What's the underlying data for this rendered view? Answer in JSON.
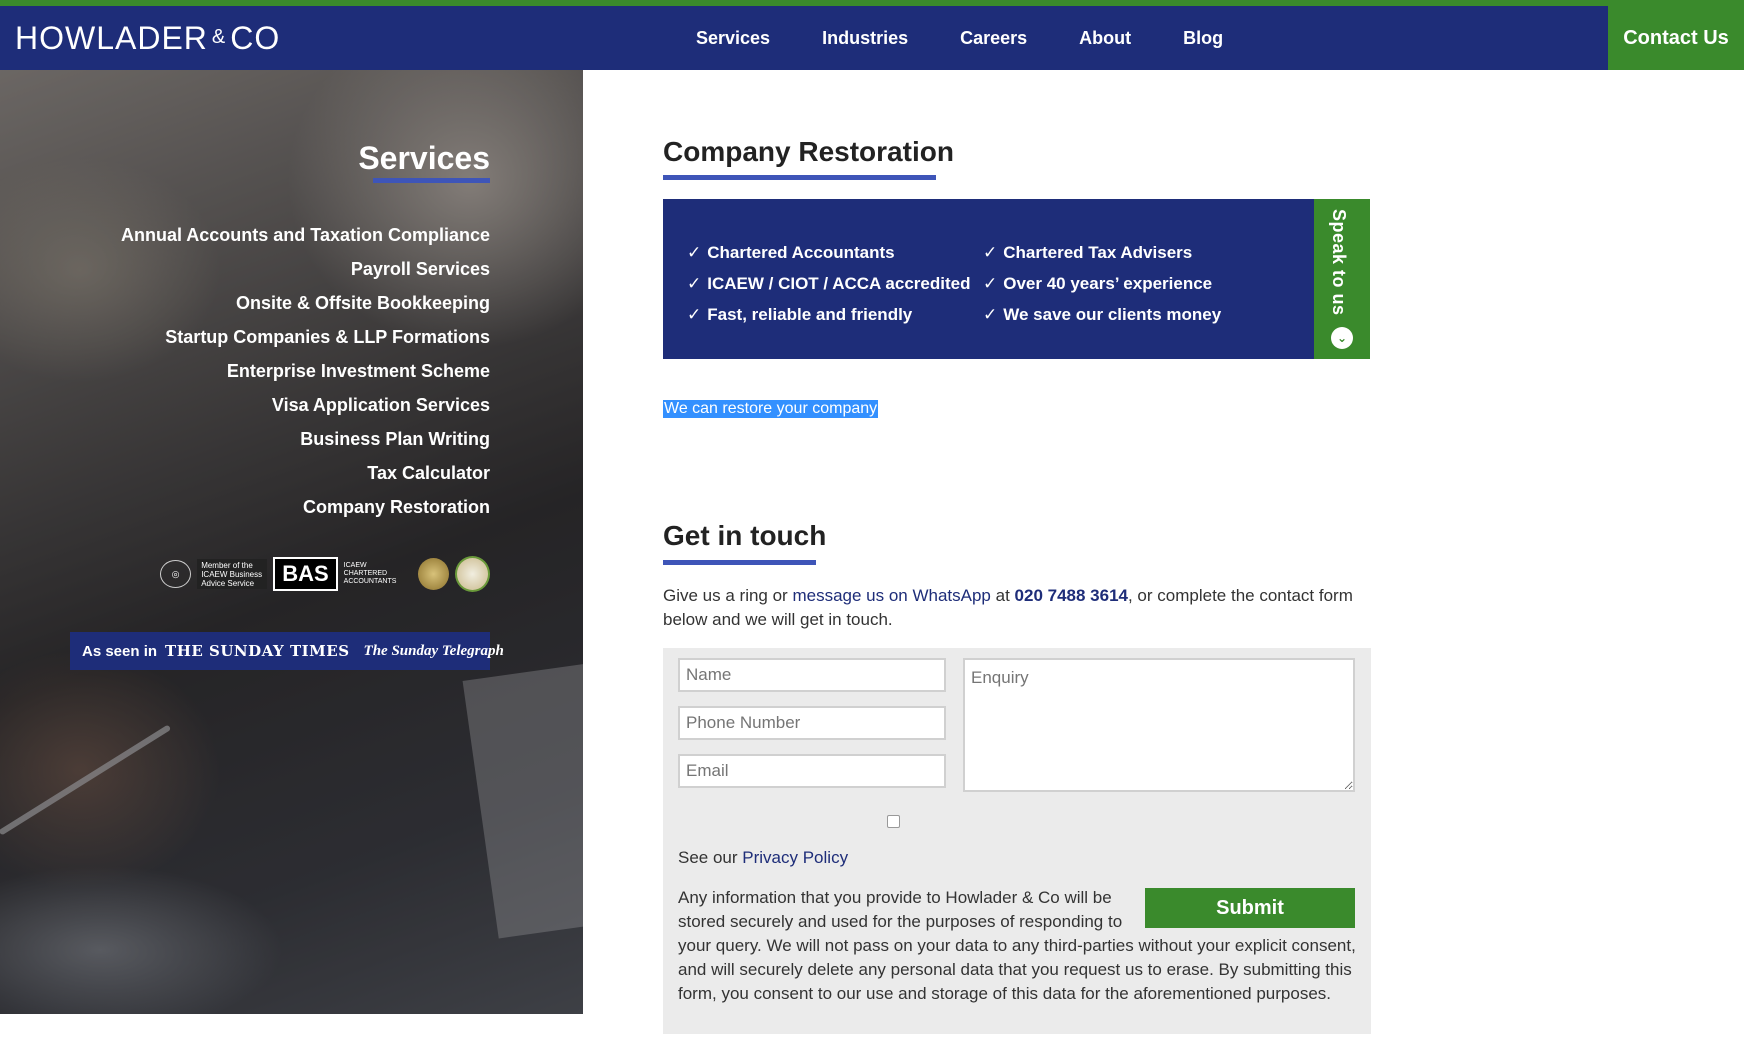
{
  "header": {
    "logo_main": "HOWLADER",
    "logo_amp": "&",
    "logo_co": "CO",
    "nav": [
      "Services",
      "Industries",
      "Careers",
      "About",
      "Blog"
    ],
    "contact_label": "Contact Us"
  },
  "sidebar": {
    "title": "Services",
    "items": [
      "Annual Accounts and Taxation Compliance",
      "Payroll Services",
      "Onsite & Offsite Bookkeeping",
      "Startup Companies & LLP Formations",
      "Enterprise Investment Scheme",
      "Visa Application Services",
      "Business Plan Writing",
      "Tax Calculator",
      "Company Restoration"
    ],
    "badges": {
      "icaew_business": "Member of the ICAEW Business Advice Service",
      "bas": "BAS",
      "chartered": "ICAEW CHARTERED ACCOUNTANTS"
    },
    "as_seen_in": "As seen in",
    "publications": [
      "THE SUNDAY TIMES",
      "The Sunday Telegraph"
    ]
  },
  "main": {
    "title": "Company Restoration",
    "usps_left": [
      "Chartered Accountants",
      "ICAEW / CIOT / ACCA accredited",
      "Fast, reliable and friendly"
    ],
    "usps_right": [
      "Chartered Tax Advisers",
      "Over 40 years’ experience",
      "We save our clients money"
    ],
    "tick": "✓",
    "speak_label": "Speak to us",
    "speak_arrow": "⌄",
    "restore_text": "We can restore your company"
  },
  "contact": {
    "title": "Get in touch",
    "intro_1": "Give us a ring or ",
    "intro_link": "message us on WhatsApp",
    "intro_2": " at ",
    "intro_phone": "020 7488 3614",
    "intro_3": ", or complete the contact form below and we will get in touch.",
    "placeholders": {
      "name": "Name",
      "phone": "Phone Number",
      "email": "Email",
      "enquiry": "Enquiry"
    },
    "privacy_prefix": "See our ",
    "privacy_link": "Privacy Policy",
    "submit_label": "Submit",
    "disclaimer": "Any information that you provide to Howlader & Co will be stored securely and used for the purposes of responding to your query. We will not pass on your data to any third-parties without your explicit consent, and will securely delete any personal data that you request us to erase. By submitting this form, you consent to our use and storage of this data for the aforementioned purposes."
  },
  "colors": {
    "navy": "#1e2d79",
    "green": "#3a8a2c",
    "accent_blue": "#3e55b8"
  }
}
